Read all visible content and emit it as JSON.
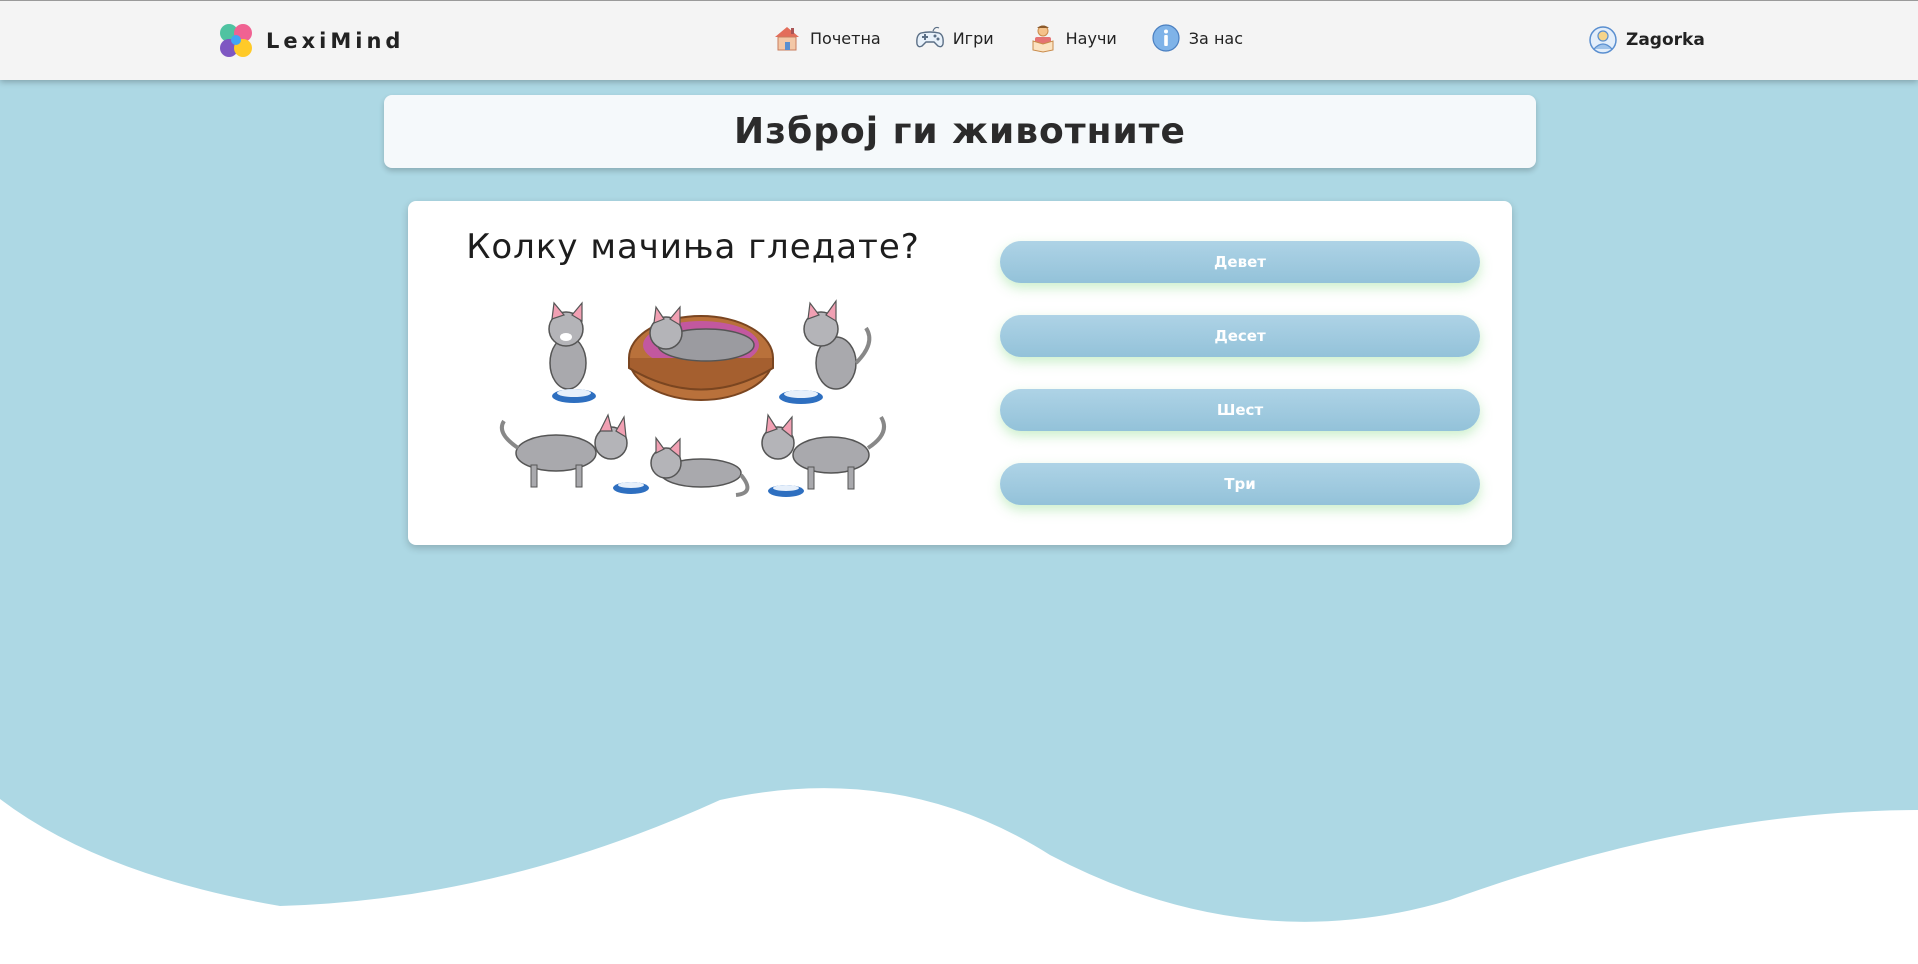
{
  "brand": {
    "name": "LexiMind",
    "logo_icon": "brain-puzzle-icon"
  },
  "nav": {
    "links": [
      {
        "label": "Почетна",
        "icon": "house-icon"
      },
      {
        "label": "Игри",
        "icon": "gamepad-icon"
      },
      {
        "label": "Научи",
        "icon": "reading-child-icon"
      },
      {
        "label": "За нас",
        "icon": "info-icon"
      }
    ]
  },
  "user": {
    "name": "Zagorka",
    "icon": "user-avatar-icon"
  },
  "game": {
    "title": "Изброј ги животните",
    "question": "Колку мачиња гледате?",
    "image": "cats-illustration",
    "answers": [
      "Девет",
      "Десет",
      "Шест",
      "Три"
    ]
  },
  "colors": {
    "background": "#ADD8E4",
    "navbar": "#f4f4f4",
    "answer_button": "#9fcbe0",
    "button_glow": "#8cdc8c"
  }
}
